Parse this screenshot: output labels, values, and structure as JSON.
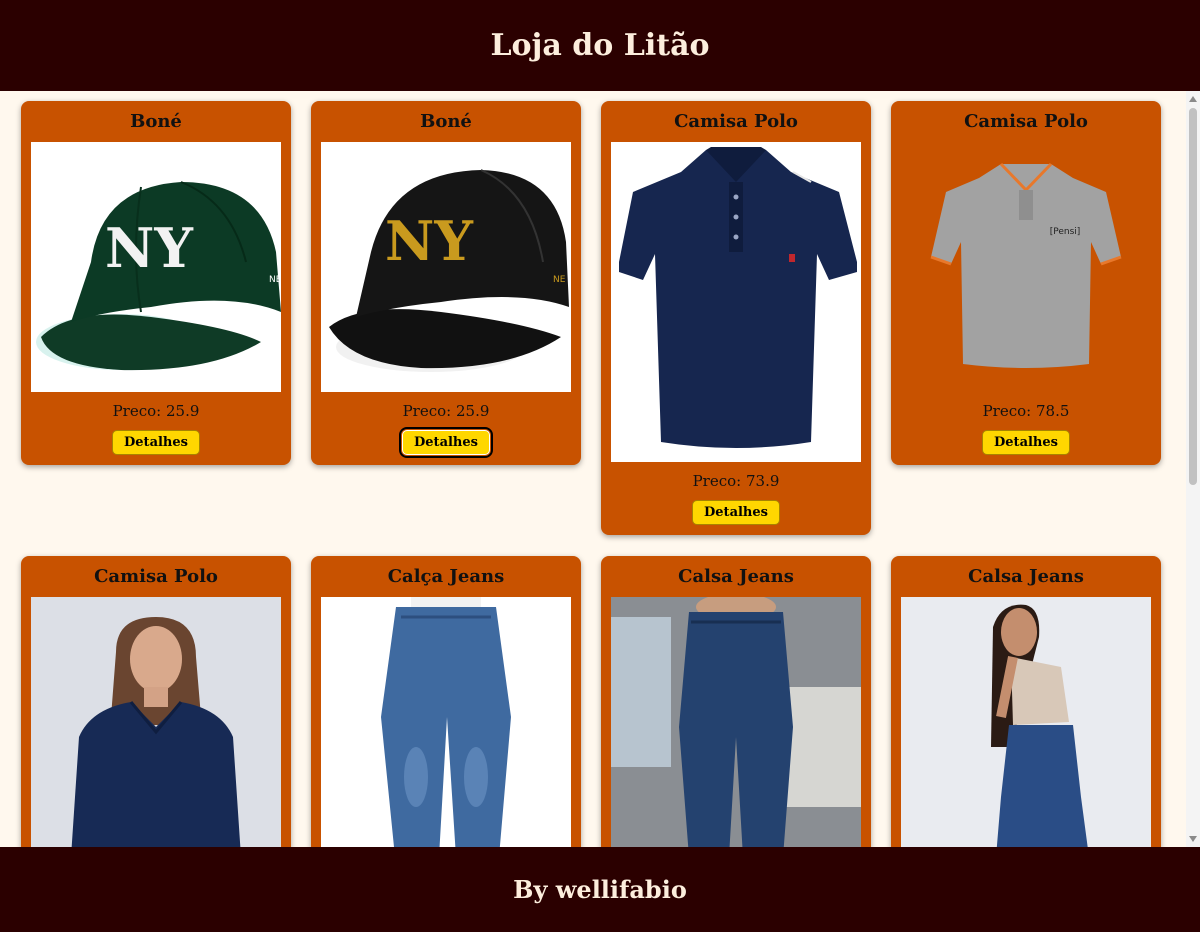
{
  "header": {
    "title": "Loja do Litão"
  },
  "footer": {
    "credit": "By wellifabio"
  },
  "products": [
    {
      "name": "Boné",
      "price_label": "Preco: 25.9",
      "button": "Detalhes"
    },
    {
      "name": "Boné",
      "price_label": "Preco: 25.9",
      "button": "Detalhes"
    },
    {
      "name": "Camisa Polo",
      "price_label": "Preco: 73.9",
      "button": "Detalhes"
    },
    {
      "name": "Camisa Polo",
      "price_label": "Preco: 78.5",
      "button": "Detalhes"
    },
    {
      "name": "Camisa Polo"
    },
    {
      "name": "Calça Jeans"
    },
    {
      "name": "Calsa Jeans"
    },
    {
      "name": "Calsa Jeans"
    }
  ],
  "image_logo_text": "Pensi",
  "colors": {
    "header_bg": "#2b0000",
    "card_bg": "#c85200",
    "button_bg": "#ffd700",
    "page_bg": "#fff8ee"
  }
}
